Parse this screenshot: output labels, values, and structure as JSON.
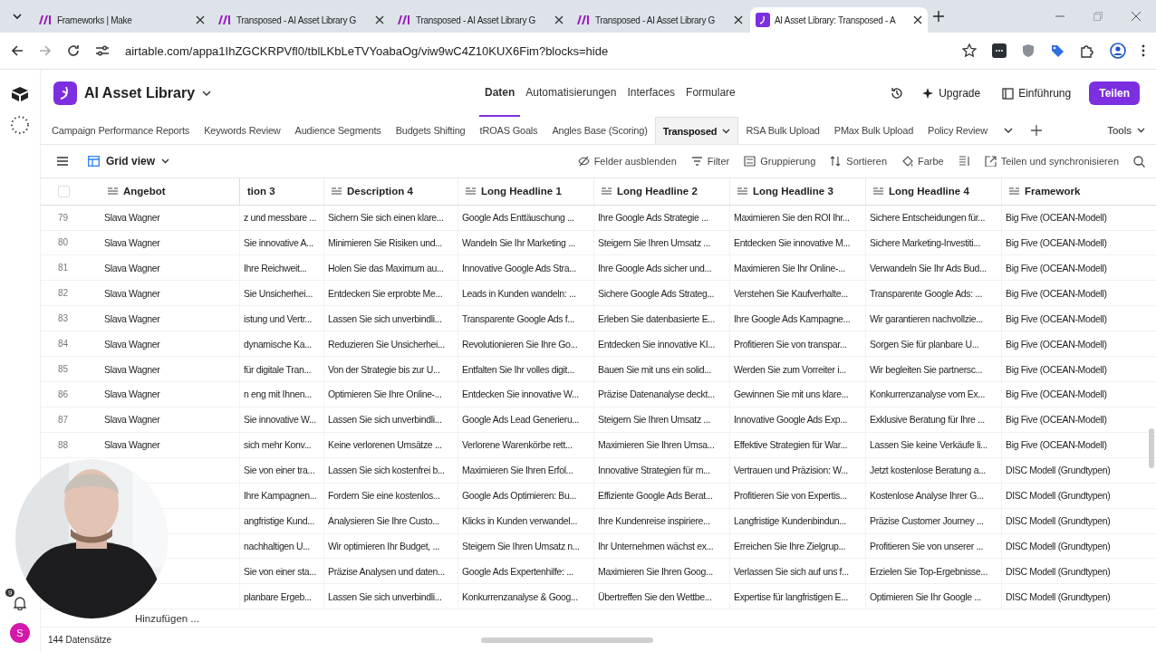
{
  "browser_tabs": [
    {
      "title": "Frameworks | Make",
      "selected": false,
      "kind": "make"
    },
    {
      "title": "Transposed - AI Asset Library G",
      "selected": false,
      "kind": "make"
    },
    {
      "title": "Transposed - AI Asset Library G",
      "selected": false,
      "kind": "make"
    },
    {
      "title": "Transposed - AI Asset Library G",
      "selected": false,
      "kind": "make"
    },
    {
      "title": "AI Asset Library: Transposed - A",
      "selected": true,
      "kind": "airtable"
    }
  ],
  "address": "airtable.com/appa1IhZGCKRPVfl0/tblLKbLeTVYoabaOg/viw9wC4Z10KUX6Fim?blocks=hide",
  "base_name": "AI Asset Library",
  "nav": [
    {
      "label": "Daten",
      "selected": true
    },
    {
      "label": "Automatisierungen",
      "selected": false
    },
    {
      "label": "Interfaces",
      "selected": false
    },
    {
      "label": "Formulare",
      "selected": false
    }
  ],
  "header_buttons": {
    "upgrade": "Upgrade",
    "guide": "Einführung",
    "share": "Teilen"
  },
  "table_tabs": [
    {
      "label": "Campaign Performance Reports",
      "selected": false
    },
    {
      "label": "Keywords Review",
      "selected": false
    },
    {
      "label": "Audience Segments",
      "selected": false
    },
    {
      "label": "Budgets Shifting",
      "selected": false
    },
    {
      "label": "tROAS Goals",
      "selected": false
    },
    {
      "label": "Angles Base (Scoring)",
      "selected": false
    },
    {
      "label": "Transposed",
      "selected": true
    },
    {
      "label": "RSA Bulk Upload",
      "selected": false
    },
    {
      "label": "PMax Bulk Upload",
      "selected": false
    },
    {
      "label": "Policy Review",
      "selected": false
    }
  ],
  "tools": "Tools",
  "view_name": "Grid view",
  "view_actions": [
    {
      "label": "Felder ausblenden",
      "kind": "hide"
    },
    {
      "label": "Filter",
      "kind": "filter"
    },
    {
      "label": "Gruppierung",
      "kind": "group"
    },
    {
      "label": "Sortieren",
      "kind": "sort"
    },
    {
      "label": "Farbe",
      "kind": "color"
    },
    {
      "kind": "height"
    },
    {
      "label": "Teilen und synchronisieren",
      "kind": "share"
    }
  ],
  "select_all_checked": false,
  "columns": [
    "Angebot",
    "tion 3",
    "Description 4",
    "Long Headline 1",
    "Long Headline 2",
    "Long Headline 3",
    "Long Headline 4",
    "Framework"
  ],
  "rows": [
    {
      "number": "79",
      "angebot": "Slava Wagner",
      "cells": [
        "z und messbare ...",
        "Sichern Sie sich einen klare...",
        "Google Ads Enttäuschung ...",
        "Ihre Google Ads Strategie ...",
        "Maximieren Sie den ROI Ihr...",
        "Sichere Entscheidungen für...",
        "Big Five (OCEAN-Modell)"
      ]
    },
    {
      "number": "80",
      "angebot": "Slava Wagner",
      "cells": [
        "Sie innovative A...",
        "Minimieren Sie Risiken und...",
        "Wandeln Sie Ihr Marketing ...",
        "Steigern Sie Ihren Umsatz ...",
        "Entdecken Sie innovative M...",
        "Sichere Marketing-Investiti...",
        "Big Five (OCEAN-Modell)"
      ]
    },
    {
      "number": "81",
      "angebot": "Slava Wagner",
      "cells": [
        "Ihre Reichweit...",
        "Holen Sie das Maximum au...",
        "Innovative Google Ads Stra...",
        "Ihre Google Ads sicher und...",
        "Maximieren Sie Ihr Online-...",
        "Verwandeln Sie Ihr Ads Bud...",
        "Big Five (OCEAN-Modell)"
      ]
    },
    {
      "number": "82",
      "angebot": "Slava Wagner",
      "cells": [
        "Sie Unsicherhei...",
        "Entdecken Sie erprobte Me...",
        "Leads in Kunden wandeln: ...",
        "Sichere Google Ads Strateg...",
        "Verstehen Sie Kaufverhalte...",
        "Transparente Google Ads: ...",
        "Big Five (OCEAN-Modell)"
      ]
    },
    {
      "number": "83",
      "angebot": "Slava Wagner",
      "cells": [
        "istung und Vertr...",
        "Lassen Sie sich unverbindli...",
        "Transparente Google Ads f...",
        "Erleben Sie datenbasierte E...",
        "Ihre Google Ads Kampagne...",
        "Wir garantieren nachvollzie...",
        "Big Five (OCEAN-Modell)"
      ]
    },
    {
      "number": "84",
      "angebot": "Slava Wagner",
      "cells": [
        "dynamische Ka...",
        "Reduzieren Sie Unsicherhei...",
        "Revolutionieren Sie Ihre Go...",
        "Entdecken Sie innovative KI...",
        "Profitieren Sie von transpar...",
        "Sorgen Sie für planbare U...",
        "Big Five (OCEAN-Modell)"
      ]
    },
    {
      "number": "85",
      "angebot": "Slava Wagner",
      "cells": [
        "für digitale Tran...",
        "Von der Strategie bis zur U...",
        "Entfalten Sie Ihr volles digit...",
        "Bauen Sie mit uns ein solid...",
        "Werden Sie zum Vorreiter i...",
        "Wir begleiten Sie partnersc...",
        "Big Five (OCEAN-Modell)"
      ]
    },
    {
      "number": "86",
      "angebot": "Slava Wagner",
      "cells": [
        "n eng mit Ihnen...",
        "Optimieren Sie Ihre Online-...",
        "Entdecken Sie innovative W...",
        "Präzise Datenanalyse deckt...",
        "Gewinnen Sie mit uns klare...",
        "Konkurrenzanalyse vom Ex...",
        "Big Five (OCEAN-Modell)"
      ]
    },
    {
      "number": "87",
      "angebot": "Slava Wagner",
      "cells": [
        "Sie innovative W...",
        "Lassen Sie sich unverbindli...",
        "Google Ads Lead Generieru...",
        "Steigern Sie Ihren Umsatz ...",
        "Innovative Google Ads Exp...",
        "Exklusive Beratung für Ihre ...",
        "Big Five (OCEAN-Modell)"
      ]
    },
    {
      "number": "88",
      "angebot": "Slava Wagner",
      "cells": [
        "sich mehr Konv...",
        "Keine verlorenen Umsätze ...",
        "Verlorene Warenkörbe rett...",
        "Maximieren Sie Ihren Umsa...",
        "Effektive Strategien für War...",
        "Lassen Sie keine Verkäufe li...",
        "Big Five (OCEAN-Modell)"
      ]
    },
    {
      "cells": [
        "Sie von einer tra...",
        "Lassen Sie sich kostenfrei b...",
        "Maximieren Sie Ihren Erfol...",
        "Innovative Strategien für m...",
        "Vertrauen und Präzision: W...",
        "Jetzt kostenlose Beratung a...",
        "DISC Modell (Grundtypen)"
      ]
    },
    {
      "cells": [
        "Ihre Kampagnen...",
        "Fordern Sie eine kostenlos...",
        "Google Ads Optimieren: Bu...",
        "Effiziente Google Ads Berat...",
        "Profitieren Sie von Expertis...",
        "Kostenlose Analyse Ihrer G...",
        "DISC Modell (Grundtypen)"
      ]
    },
    {
      "cells": [
        "angfristige Kund...",
        "Analysieren Sie Ihre Custo...",
        "Klicks in Kunden verwandel...",
        "Ihre Kundenreise inspiriere...",
        "Langfristige Kundenbindun...",
        "Präzise Customer Journey ...",
        "DISC Modell (Grundtypen)"
      ]
    },
    {
      "cells": [
        "nachhaltigen U...",
        "Wir optimieren Ihr Budget, ...",
        "Steigern Sie Ihren Umsatz n...",
        "Ihr Unternehmen wächst ex...",
        "Erreichen Sie Ihre Zielgrup...",
        "Profitieren Sie von unserer ...",
        "DISC Modell (Grundtypen)"
      ]
    },
    {
      "cells": [
        "Sie von einer sta...",
        "Präzise Analysen und daten...",
        "Google Ads Expertenhilfe: ...",
        "Maximieren Sie Ihren Goog...",
        "Verlassen Sie sich auf uns f...",
        "Erzielen Sie Top-Ergebnisse...",
        "DISC Modell (Grundtypen)"
      ]
    },
    {
      "cells": [
        "planbare Ergeb...",
        "Lassen Sie sich unverbindli...",
        "Konkurrenzanalyse & Goog...",
        "Übertreffen Sie den Wettbe...",
        "Expertise für langfristigen E...",
        "Optimieren Sie Ihr Google ...",
        "DISC Modell (Grundtypen)"
      ]
    }
  ],
  "add_row": "Hinzufügen ...",
  "record_count": "144 Datensätze",
  "notification_badge": "9",
  "avatar": "S"
}
